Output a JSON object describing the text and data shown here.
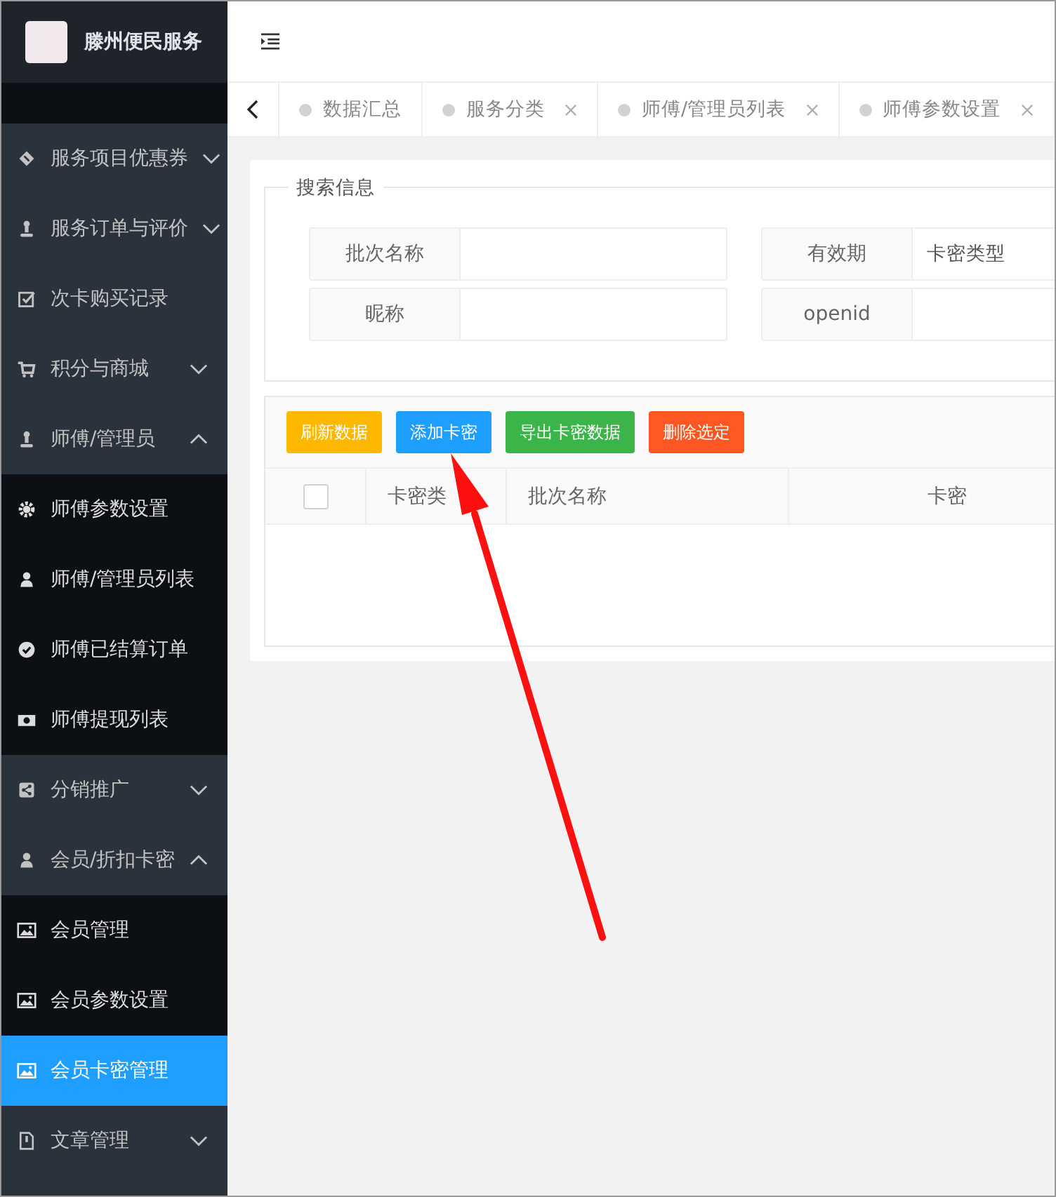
{
  "sidebar": {
    "title": "滕州便民服务",
    "items": [
      {
        "label": "服务项目优惠券",
        "expanded": false
      },
      {
        "label": "服务订单与评价",
        "expanded": false
      },
      {
        "label": "次卡购买记录"
      },
      {
        "label": "积分与商城",
        "expanded": false
      },
      {
        "label": "师傅/管理员",
        "expanded": true,
        "children": [
          {
            "label": "师傅参数设置",
            "selected": false
          },
          {
            "label": "师傅/管理员列表",
            "selected": false
          },
          {
            "label": "师傅已结算订单",
            "selected": false
          },
          {
            "label": "师傅提现列表",
            "selected": false
          }
        ]
      },
      {
        "label": "分销推广",
        "expanded": false
      },
      {
        "label": "会员/折扣卡密",
        "expanded": true,
        "children": [
          {
            "label": "会员管理",
            "selected": false
          },
          {
            "label": "会员参数设置",
            "selected": false
          },
          {
            "label": "会员卡密管理",
            "selected": true
          }
        ]
      },
      {
        "label": "文章管理",
        "expanded": false
      }
    ]
  },
  "tabs": [
    {
      "label": "数据汇总",
      "closable": false
    },
    {
      "label": "服务分类",
      "closable": true
    },
    {
      "label": "师傅/管理员列表",
      "closable": true
    },
    {
      "label": "师傅参数设置",
      "closable": true
    }
  ],
  "search": {
    "legend": "搜索信息",
    "fields": [
      {
        "label": "批次名称"
      },
      {
        "label": "有效期",
        "placeholder": "卡密类型"
      },
      {
        "label": "昵称"
      },
      {
        "label": "openid"
      }
    ]
  },
  "toolbar": [
    {
      "label": "刷新数据",
      "color": "#ffb800"
    },
    {
      "label": "添加卡密",
      "color": "#1e9fff"
    },
    {
      "label": "导出卡密数据",
      "color": "#3bb54a"
    },
    {
      "label": "删除选定",
      "color": "#ff5722"
    }
  ],
  "table": {
    "columns": [
      "卡密类",
      "批次名称",
      "卡密"
    ],
    "all_checked": false
  }
}
